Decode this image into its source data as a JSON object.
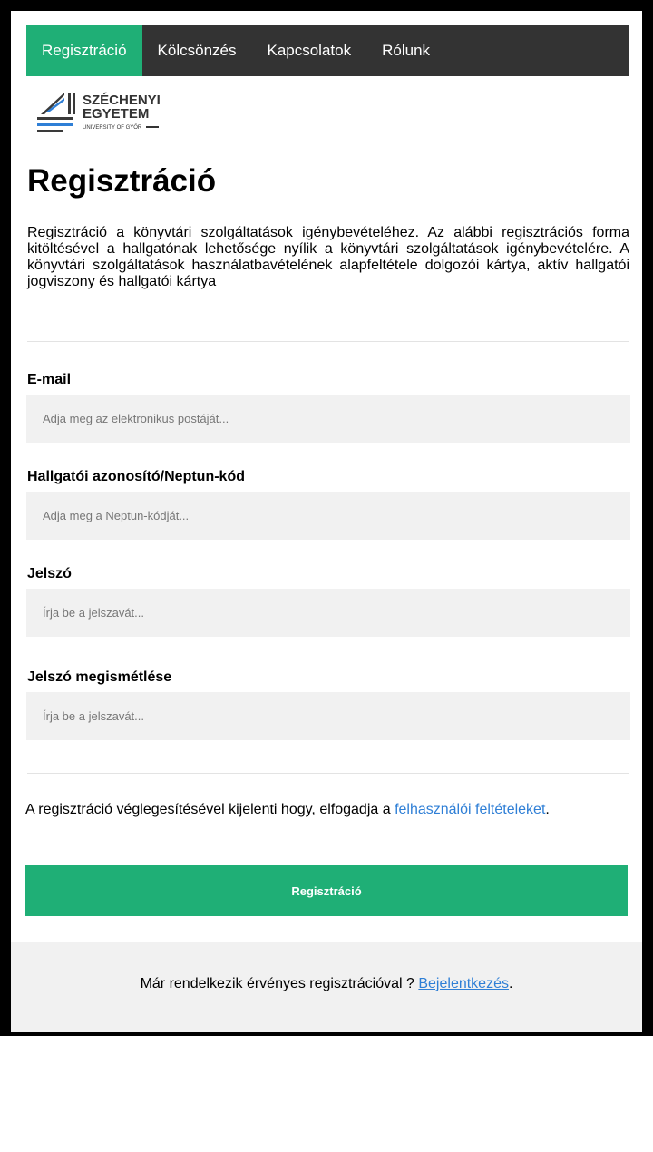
{
  "nav": {
    "items": [
      {
        "label": "Regisztráció",
        "active": true
      },
      {
        "label": "Kölcsönzés",
        "active": false
      },
      {
        "label": "Kapcsolatok",
        "active": false
      },
      {
        "label": "Rólunk",
        "active": false
      }
    ]
  },
  "logo": {
    "line1": "SZÉCHENYI",
    "line2": "EGYETEM",
    "line3": "UNIVERSITY OF GYŐR"
  },
  "page": {
    "title": "Regisztráció",
    "intro": "Regisztráció a könyvtári szolgáltatások igénybevételéhez. Az alábbi regisztrációs forma kitöltésével a hallgatónak lehetősége nyílik a könyvtári szolgáltatások igénybevételére. A könyvtári szolgáltatások használatbavételének alapfeltétele dolgozói kártya, aktív hallgatói jogviszony és hallgatói kártya"
  },
  "form": {
    "email": {
      "label": "E-mail",
      "placeholder": "Adja meg az elektronikus postáját...",
      "value": ""
    },
    "neptun": {
      "label": "Hallgatói azonosító/Neptun-kód",
      "placeholder": "Adja meg a Neptun-kódját...",
      "value": ""
    },
    "password": {
      "label": "Jelszó",
      "placeholder": "Írja be a jelszavát...",
      "value": ""
    },
    "password_repeat": {
      "label": "Jelszó megismétlése",
      "placeholder": "Írja be a jelszavát...",
      "value": ""
    }
  },
  "terms": {
    "text": "A regisztráció véglegesítésével kijelenti hogy, elfogadja a ",
    "link": "felhasználói feltételeket",
    "suffix": "."
  },
  "submit": {
    "label": "Regisztráció"
  },
  "footer": {
    "text": "Már rendelkezik érvényes regisztrációval ? ",
    "link": "Bejelentkezés",
    "suffix": "."
  },
  "colors": {
    "accent": "#1faf76",
    "nav_bg": "#333333",
    "link": "#2f7fd6",
    "input_bg": "#f1f1f1"
  }
}
